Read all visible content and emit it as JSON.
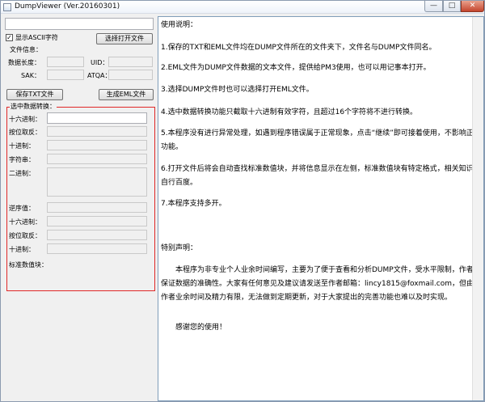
{
  "window": {
    "title": "DumpViewer (Ver.20160301)"
  },
  "window_controls": {
    "minimize": "—",
    "maximize": "□",
    "close": "✕"
  },
  "left": {
    "show_ascii_label": "显示ASCII字符",
    "show_ascii_checked": true,
    "check_mark": "✓",
    "open_file_button": "选择打开文件",
    "file_info_label": "文件信息：",
    "data_length_label": "数据长度：",
    "uid_label": "UID：",
    "sak_label": "SAK：",
    "atqa_label": "ATQA：",
    "save_txt_button": "保存TXT文件",
    "gen_eml_button": "生成EML文件",
    "selection_label": "选中数据转换：",
    "hex_label": "十六进制：",
    "bit_inverse_label": "按位取反：",
    "decimal_label": "十进制：",
    "string_label": "字符串：",
    "binary_label": "二进制：",
    "reverse_label": "逆序值：",
    "rev_hex_label": "十六进制：",
    "rev_bit_inverse_label": "按位取反：",
    "rev_decimal_label": "十进制：",
    "std_value_label": "标准数值块："
  },
  "help": {
    "heading": "使用说明：",
    "items": [
      "1.保存的TXT和EML文件均在DUMP文件所在的文件夹下，文件名与DUMP文件同名。",
      "2.EML文件为DUMP文件数据的文本文件，提供给PM3使用，也可以用记事本打开。",
      "3.选择DUMP文件时也可以选择打开EML文件。",
      "4.选中数据转换功能只截取十六进制有效字符，且超过16个字符将不进行转换。",
      "5.本程序没有进行异常处理，如遇到程序错误属于正常现象，点击“继续”即可接着使用，不影响正常功能。",
      "6.打开文件后将会自动查找标准数值块，并将信息显示在左侧，标准数值块有特定格式，相关知识请自行百度。",
      "7.本程序支持多开。"
    ],
    "notice_heading": "特别声明：",
    "notice_body": "本程序为非专业个人业余时间编写，主要为了便于查看和分析DUMP文件，受水平限制，作者不保证数据的准确性。大家有任何意见及建议请发送至作者邮箱：lincy1815@foxmail.com，但由于作者业余时间及精力有限，无法做到定期更新，对于大家提出的完善功能也难以及时实现。",
    "thanks": "感谢您的使用！"
  }
}
